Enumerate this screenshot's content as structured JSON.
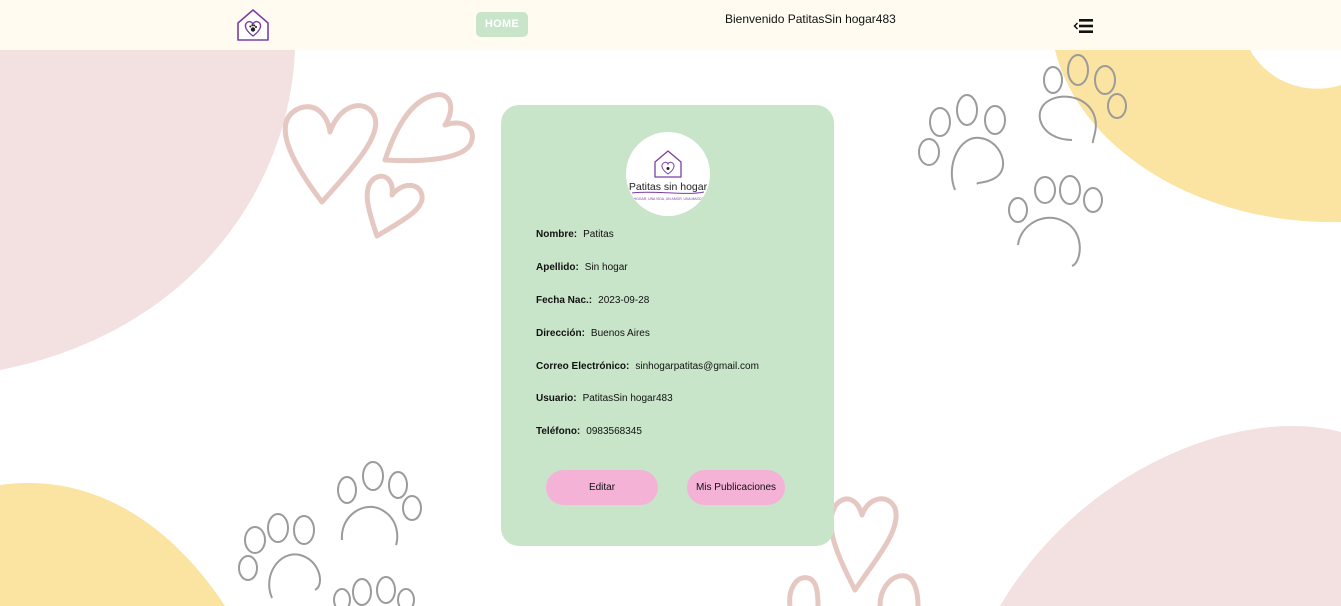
{
  "header": {
    "home_label": "HOME",
    "welcome_text": "Bienvenido PatitasSin hogar483"
  },
  "avatar": {
    "brand_name": "Patitas sin hogar",
    "tagline": "UN HOGAR, UNA VIDA, UN AMOR, UNA MASCOTA"
  },
  "profile": {
    "fields": [
      {
        "label": "Nombre:",
        "value": "Patitas"
      },
      {
        "label": "Apellido:",
        "value": "Sin hogar"
      },
      {
        "label": "Fecha Nac.:",
        "value": "2023-09-28"
      },
      {
        "label": "Dirección:",
        "value": "Buenos Aires"
      },
      {
        "label": "Correo Electrónico:",
        "value": "sinhogarpatitas@gmail.com"
      },
      {
        "label": "Usuario:",
        "value": "PatitasSin hogar483"
      },
      {
        "label": "Teléfono:",
        "value": "0983568345"
      }
    ]
  },
  "actions": {
    "edit_label": "Editar",
    "posts_label": "Mis Publicaciones"
  },
  "colors": {
    "header_bg": "#fffbf1",
    "accent_green": "#c8e5c9",
    "button_pink": "#f4b2d7",
    "blob_pink": "#f2e1e0",
    "blob_yellow": "#fbe3a1",
    "brand_purple": "#7b3fa6"
  },
  "icons": {
    "logo": "house-heart-paw-icon",
    "menu": "menu-collapse-icon"
  }
}
